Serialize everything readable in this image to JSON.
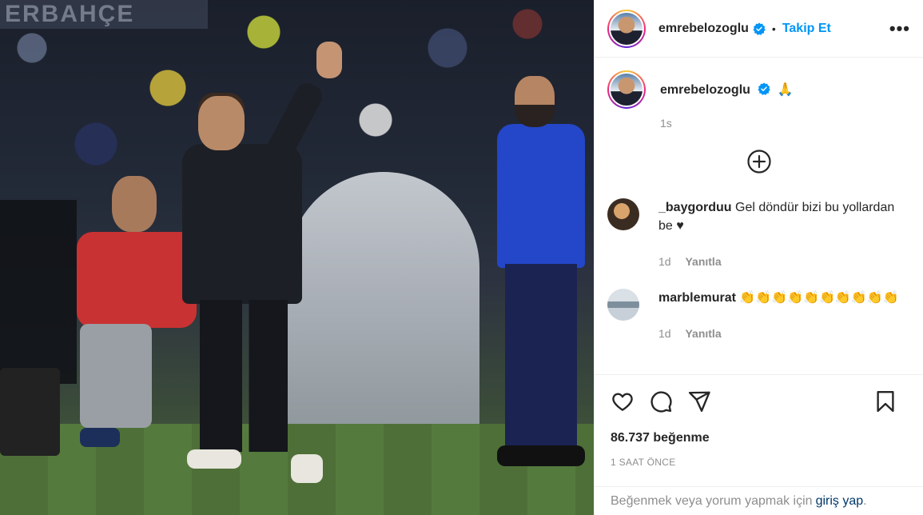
{
  "media": {
    "banner_text": "ERBAHÇE",
    "alt": "Photo by emrebelozoglu"
  },
  "header": {
    "username": "emrebelozoglu",
    "separator": "•",
    "follow_label": "Takip Et",
    "more_label": "•••",
    "verified_icon": "verified-badge-icon",
    "accent_color": "#0095f6"
  },
  "caption": {
    "username": "emrebelozoglu",
    "text": "🙏",
    "time": "1s"
  },
  "load_more_icon": "plus-circle-icon",
  "comments": [
    {
      "username": "_baygorduu",
      "text": "Gel döndür bizi bu yollardan be ♥",
      "time": "1d",
      "reply_label": "Yanıtla"
    },
    {
      "username": "marblemurat",
      "text": "👏👏👏👏👏👏👏👏👏👏",
      "time": "1d",
      "reply_label": "Yanıtla"
    }
  ],
  "actions": {
    "like_icon": "heart-icon",
    "comment_icon": "comment-icon",
    "share_icon": "send-icon",
    "save_icon": "bookmark-icon",
    "likes": "86.737 beğenme",
    "posted": "1 saat önce"
  },
  "login_bar": {
    "prompt": "Beğenmek veya yorum yapmak için",
    "link": "giriş yap",
    "suffix": "."
  }
}
